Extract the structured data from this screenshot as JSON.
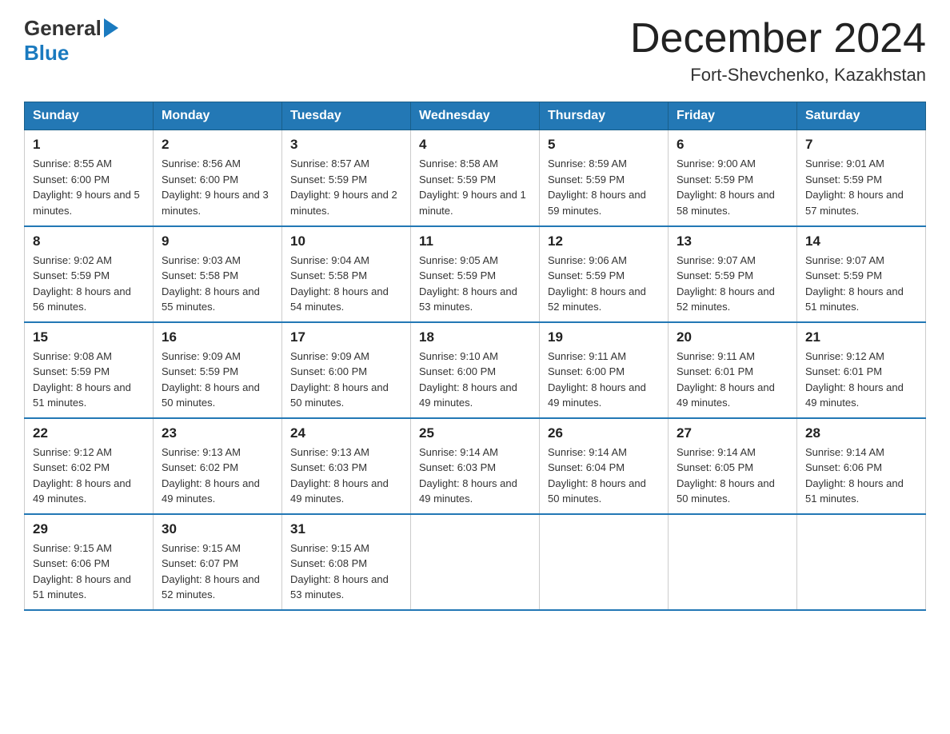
{
  "header": {
    "logo_general": "General",
    "logo_blue": "Blue",
    "month_title": "December 2024",
    "location": "Fort-Shevchenko, Kazakhstan"
  },
  "weekdays": [
    "Sunday",
    "Monday",
    "Tuesday",
    "Wednesday",
    "Thursday",
    "Friday",
    "Saturday"
  ],
  "weeks": [
    [
      {
        "day": "1",
        "sunrise": "8:55 AM",
        "sunset": "6:00 PM",
        "daylight": "9 hours and 5 minutes."
      },
      {
        "day": "2",
        "sunrise": "8:56 AM",
        "sunset": "6:00 PM",
        "daylight": "9 hours and 3 minutes."
      },
      {
        "day": "3",
        "sunrise": "8:57 AM",
        "sunset": "5:59 PM",
        "daylight": "9 hours and 2 minutes."
      },
      {
        "day": "4",
        "sunrise": "8:58 AM",
        "sunset": "5:59 PM",
        "daylight": "9 hours and 1 minute."
      },
      {
        "day": "5",
        "sunrise": "8:59 AM",
        "sunset": "5:59 PM",
        "daylight": "8 hours and 59 minutes."
      },
      {
        "day": "6",
        "sunrise": "9:00 AM",
        "sunset": "5:59 PM",
        "daylight": "8 hours and 58 minutes."
      },
      {
        "day": "7",
        "sunrise": "9:01 AM",
        "sunset": "5:59 PM",
        "daylight": "8 hours and 57 minutes."
      }
    ],
    [
      {
        "day": "8",
        "sunrise": "9:02 AM",
        "sunset": "5:59 PM",
        "daylight": "8 hours and 56 minutes."
      },
      {
        "day": "9",
        "sunrise": "9:03 AM",
        "sunset": "5:58 PM",
        "daylight": "8 hours and 55 minutes."
      },
      {
        "day": "10",
        "sunrise": "9:04 AM",
        "sunset": "5:58 PM",
        "daylight": "8 hours and 54 minutes."
      },
      {
        "day": "11",
        "sunrise": "9:05 AM",
        "sunset": "5:59 PM",
        "daylight": "8 hours and 53 minutes."
      },
      {
        "day": "12",
        "sunrise": "9:06 AM",
        "sunset": "5:59 PM",
        "daylight": "8 hours and 52 minutes."
      },
      {
        "day": "13",
        "sunrise": "9:07 AM",
        "sunset": "5:59 PM",
        "daylight": "8 hours and 52 minutes."
      },
      {
        "day": "14",
        "sunrise": "9:07 AM",
        "sunset": "5:59 PM",
        "daylight": "8 hours and 51 minutes."
      }
    ],
    [
      {
        "day": "15",
        "sunrise": "9:08 AM",
        "sunset": "5:59 PM",
        "daylight": "8 hours and 51 minutes."
      },
      {
        "day": "16",
        "sunrise": "9:09 AM",
        "sunset": "5:59 PM",
        "daylight": "8 hours and 50 minutes."
      },
      {
        "day": "17",
        "sunrise": "9:09 AM",
        "sunset": "6:00 PM",
        "daylight": "8 hours and 50 minutes."
      },
      {
        "day": "18",
        "sunrise": "9:10 AM",
        "sunset": "6:00 PM",
        "daylight": "8 hours and 49 minutes."
      },
      {
        "day": "19",
        "sunrise": "9:11 AM",
        "sunset": "6:00 PM",
        "daylight": "8 hours and 49 minutes."
      },
      {
        "day": "20",
        "sunrise": "9:11 AM",
        "sunset": "6:01 PM",
        "daylight": "8 hours and 49 minutes."
      },
      {
        "day": "21",
        "sunrise": "9:12 AM",
        "sunset": "6:01 PM",
        "daylight": "8 hours and 49 minutes."
      }
    ],
    [
      {
        "day": "22",
        "sunrise": "9:12 AM",
        "sunset": "6:02 PM",
        "daylight": "8 hours and 49 minutes."
      },
      {
        "day": "23",
        "sunrise": "9:13 AM",
        "sunset": "6:02 PM",
        "daylight": "8 hours and 49 minutes."
      },
      {
        "day": "24",
        "sunrise": "9:13 AM",
        "sunset": "6:03 PM",
        "daylight": "8 hours and 49 minutes."
      },
      {
        "day": "25",
        "sunrise": "9:14 AM",
        "sunset": "6:03 PM",
        "daylight": "8 hours and 49 minutes."
      },
      {
        "day": "26",
        "sunrise": "9:14 AM",
        "sunset": "6:04 PM",
        "daylight": "8 hours and 50 minutes."
      },
      {
        "day": "27",
        "sunrise": "9:14 AM",
        "sunset": "6:05 PM",
        "daylight": "8 hours and 50 minutes."
      },
      {
        "day": "28",
        "sunrise": "9:14 AM",
        "sunset": "6:06 PM",
        "daylight": "8 hours and 51 minutes."
      }
    ],
    [
      {
        "day": "29",
        "sunrise": "9:15 AM",
        "sunset": "6:06 PM",
        "daylight": "8 hours and 51 minutes."
      },
      {
        "day": "30",
        "sunrise": "9:15 AM",
        "sunset": "6:07 PM",
        "daylight": "8 hours and 52 minutes."
      },
      {
        "day": "31",
        "sunrise": "9:15 AM",
        "sunset": "6:08 PM",
        "daylight": "8 hours and 53 minutes."
      },
      null,
      null,
      null,
      null
    ]
  ],
  "labels": {
    "sunrise": "Sunrise:",
    "sunset": "Sunset:",
    "daylight": "Daylight:"
  }
}
